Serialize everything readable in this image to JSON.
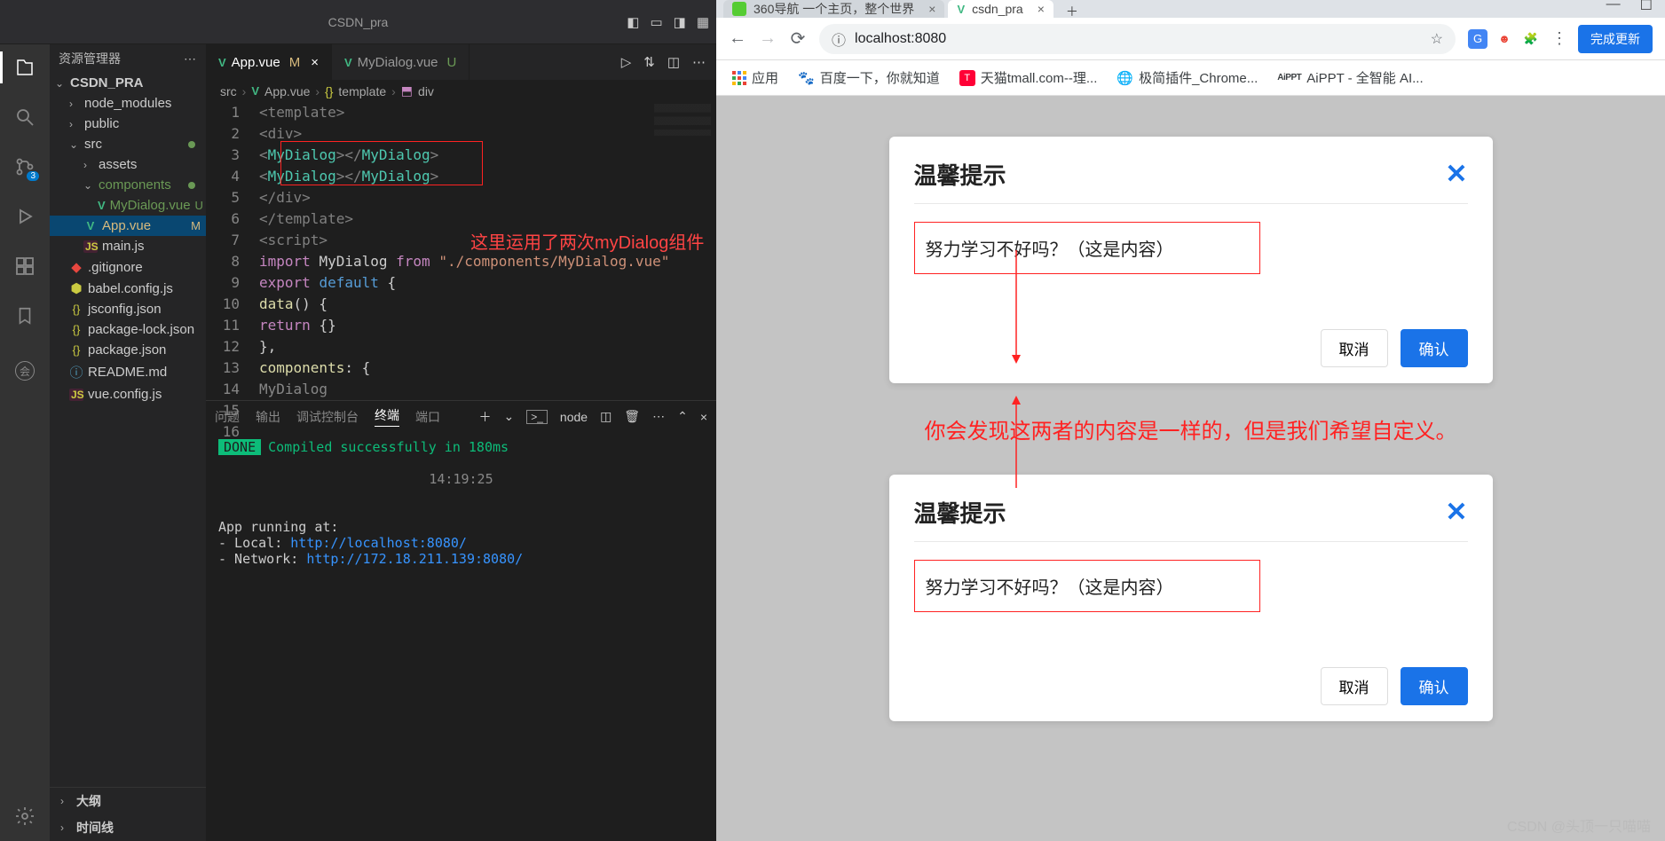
{
  "vscode": {
    "top_filename": "CSDN_pra",
    "sidebar_title": "资源管理器",
    "project": "CSDN_PRA",
    "tree": {
      "node_modules": "node_modules",
      "public": "public",
      "src": "src",
      "assets": "assets",
      "components": "components",
      "mydialog": "MyDialog.vue",
      "appvue": "App.vue",
      "mainjs": "main.js",
      "gitignore": ".gitignore",
      "babel": "babel.config.js",
      "jsconfig": "jsconfig.json",
      "pkglock": "package-lock.json",
      "pkg": "package.json",
      "readme": "README.md",
      "vueconfig": "vue.config.js"
    },
    "status_u": "U",
    "status_m": "M",
    "outline": "大纲",
    "timeline": "时间线",
    "tabs": {
      "app": "App.vue",
      "dlg": "MyDialog.vue"
    },
    "breadcrumb": {
      "src": "src",
      "app": "App.vue",
      "tpl": "template",
      "div": "div"
    },
    "code": {
      "l1": "<template>",
      "l2": "  <div>",
      "l3a": "    <",
      "l3b": "MyDialog",
      "l3c": "></",
      "l3d": "MyDialog",
      "l3e": ">",
      "l4a": "    <",
      "l4b": "MyDialog",
      "l4c": "></",
      "l4d": "MyDialog",
      "l4e": ">",
      "l5": "",
      "l6": "  </div>",
      "l7": "</template>",
      "l8": "",
      "l9": "<script>",
      "l10a": "import ",
      "l10b": "MyDialog ",
      "l10c": "from ",
      "l10d": "\"./components/MyDialog.vue\"",
      "l11a": "export ",
      "l11b": "default ",
      "l11c": "{",
      "l12a": "  data",
      "l12b": "() {",
      "l13a": "    return ",
      "l13b": "{}",
      "l14": "  },",
      "l15a": "  components",
      "l15b": ": {",
      "l16": "    MyDialog"
    },
    "code_note": "这里运用了两次myDialog组件",
    "terminal": {
      "tabs": {
        "problems": "问题",
        "output": "输出",
        "debug": "调试控制台",
        "terminal": "终端",
        "ports": "端口"
      },
      "shell": "node",
      "done": "DONE",
      "compiled": "Compiled successfully in 180ms",
      "time": "14:19:25",
      "running": "App running at:",
      "local_lbl": "- Local:   ",
      "local_url": "http://localhost:8080/",
      "net_lbl": "- Network: ",
      "net_url": "http://172.18.211.139:8080/"
    }
  },
  "browser": {
    "tabs": {
      "t1": "360导航  一个主页，整个世界",
      "t2": "csdn_pra"
    },
    "url_info_icon": "ⓘ",
    "url": "localhost:8080",
    "update": "完成更新",
    "bookmarks": {
      "apps": "应用",
      "baidu": "百度一下，你就知道",
      "tmall": "天猫tmall.com--理...",
      "chrome": "极简插件_Chrome...",
      "aippt": "AiPPT - 全智能 AI..."
    },
    "dialog": {
      "title": "温馨提示",
      "content": "努力学习不好吗？（这是内容）",
      "cancel": "取消",
      "ok": "确认"
    },
    "mid_note": "你会发现这两者的内容是一样的，但是我们希望自定义。",
    "watermark": "CSDN @头顶一只喵喵"
  }
}
